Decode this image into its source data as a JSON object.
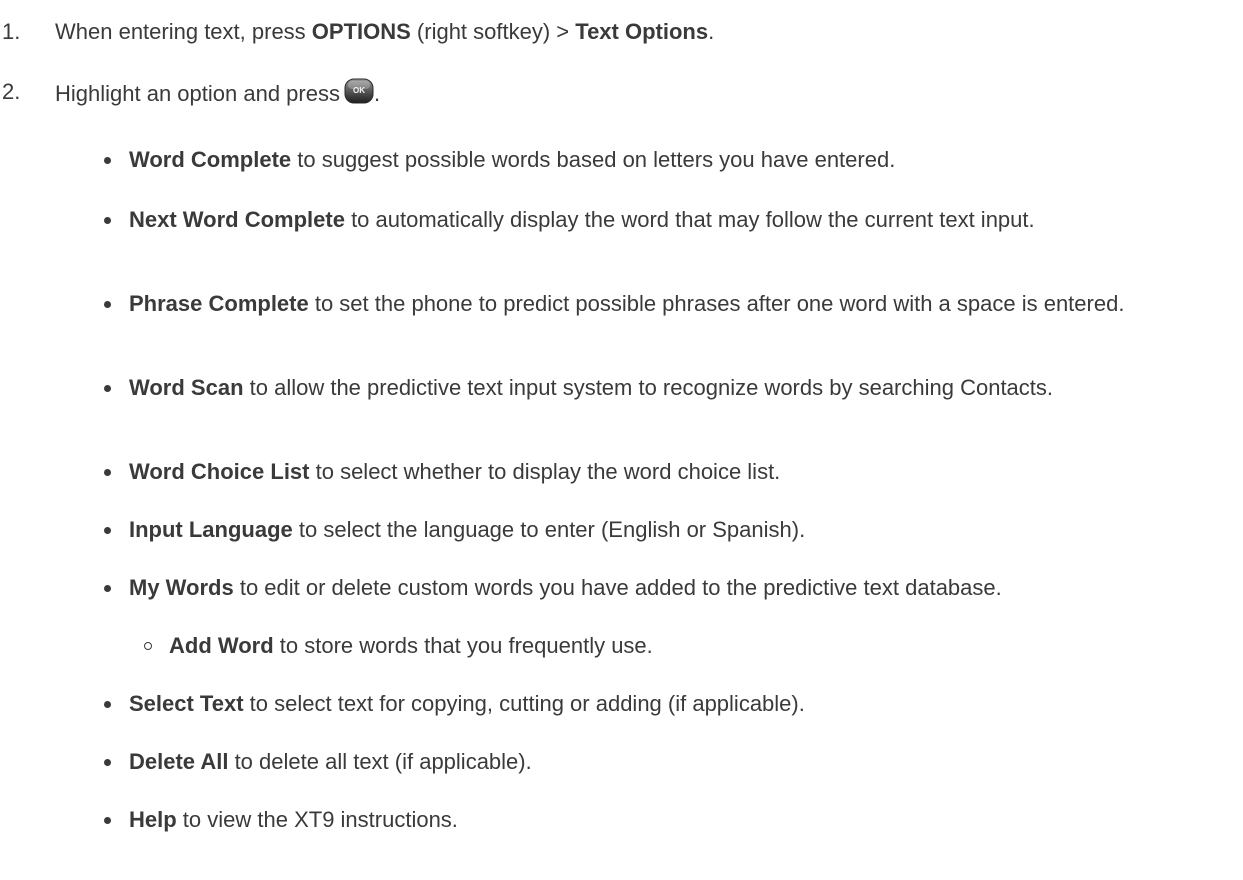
{
  "steps": [
    {
      "number": "1.",
      "parts": [
        "When entering text, press ",
        "OPTIONS",
        " (right softkey) > ",
        "Text Options",
        "."
      ]
    },
    {
      "number": "2.",
      "text_before_icon": "Highlight an option and press",
      "icon_label": "OK",
      "text_after_icon": "."
    }
  ],
  "options": [
    {
      "term": "Word Complete",
      "desc": " to suggest possible words based on letters you have entered."
    },
    {
      "term": "Next Word Complete",
      "desc": " to automatically display the word that may follow the current text input."
    },
    {
      "term": "Phrase Complete",
      "desc": " to set the phone to predict possible phrases after one word with a space is entered."
    },
    {
      "term": "Word Scan",
      "desc": " to allow the predictive text input system to recognize words by searching Contacts."
    },
    {
      "term": "Word Choice List",
      "desc": " to select whether to display the word choice list."
    },
    {
      "term": "Input Language",
      "desc": " to select the language to enter (English or Spanish)."
    },
    {
      "term": "My Words",
      "desc": " to edit or delete custom words you have added to the predictive text database."
    },
    {
      "term": "Add Word",
      "desc": " to store words that you frequently use."
    },
    {
      "term": "Select Text",
      "desc": " to select text for copying, cutting or adding (if applicable)."
    },
    {
      "term": "Delete All",
      "desc": " to delete all text (if applicable)."
    },
    {
      "term": "Help",
      "desc": " to view the XT9 instructions."
    }
  ]
}
